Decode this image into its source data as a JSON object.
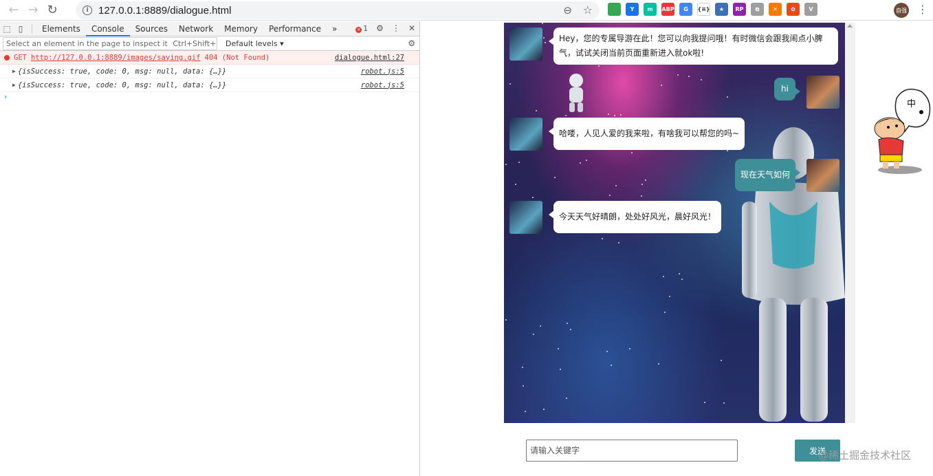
{
  "browser": {
    "url": "127.0.0.1:8889/dialogue.html",
    "profile_label": "自强",
    "extensions": [
      {
        "name": "ext-1",
        "color": "#34a853",
        "label": ""
      },
      {
        "name": "ext-2",
        "color": "#1a73e8",
        "label": "Y"
      },
      {
        "name": "ext-3",
        "color": "#00c2a0",
        "label": "m"
      },
      {
        "name": "ext-abp",
        "color": "#e53935",
        "label": "ABP"
      },
      {
        "name": "ext-translate",
        "color": "#4285f4",
        "label": "G"
      },
      {
        "name": "ext-json",
        "color": "#ffffff",
        "label": "{≡}"
      },
      {
        "name": "ext-7",
        "color": "#3b6fb6",
        "label": "★"
      },
      {
        "name": "ext-rp",
        "color": "#8e24aa",
        "label": "RP"
      },
      {
        "name": "ext-9",
        "color": "#9e9e9e",
        "label": "⧉"
      },
      {
        "name": "ext-10",
        "color": "#f57c00",
        "label": "✕"
      },
      {
        "name": "ext-11",
        "color": "#e64a19",
        "label": "✿"
      },
      {
        "name": "ext-12",
        "color": "#9e9e9e",
        "label": "V"
      }
    ]
  },
  "devtools": {
    "tabs": [
      "Elements",
      "Console",
      "Sources",
      "Network",
      "Memory",
      "Performance"
    ],
    "active_tab": "Console",
    "more": "»",
    "error_count": "1",
    "filter_hint": "Select an element in the page to inspect it",
    "filter_shortcut": "Ctrl+Shift+C",
    "levels": "Default levels ▾",
    "logs": {
      "error": {
        "method": "GET",
        "url": "http://127.0.0.1:8889/images/saying.gif",
        "status": "404 (Not Found)",
        "source": "dialogue.html:27"
      },
      "obj1": {
        "text": "{isSuccess: true, code: 0, msg: null, data: {…}}",
        "source": "robot.js:5"
      },
      "obj2": {
        "text": "{isSuccess: true, code: 0, msg: null, data: {…}}",
        "source": "robot.js:5"
      }
    },
    "prompt": "›"
  },
  "chat": {
    "messages": [
      {
        "from": "bot",
        "text": "Hey，您的专属导游在此！您可以向我提问哦！有时微信会跟我闹点小脾气，试试关闭当前页面重新进入就ok啦!"
      },
      {
        "from": "user",
        "text": "hi"
      },
      {
        "from": "bot",
        "text": "哈喽，人见人爱的我来啦，有啥我可以帮您的吗~"
      },
      {
        "from": "user",
        "text": "现在天气如何"
      },
      {
        "from": "bot",
        "text": "今天天气好晴朗，处处好风光，晨好风光！"
      }
    ],
    "input_placeholder": "请输入关键字",
    "send_label": "发送",
    "colors": {
      "accent": "#3f8f99",
      "bubble": "#ffffff"
    }
  },
  "watermark": "@稀土掘金技术社区",
  "mascot_text": "中"
}
